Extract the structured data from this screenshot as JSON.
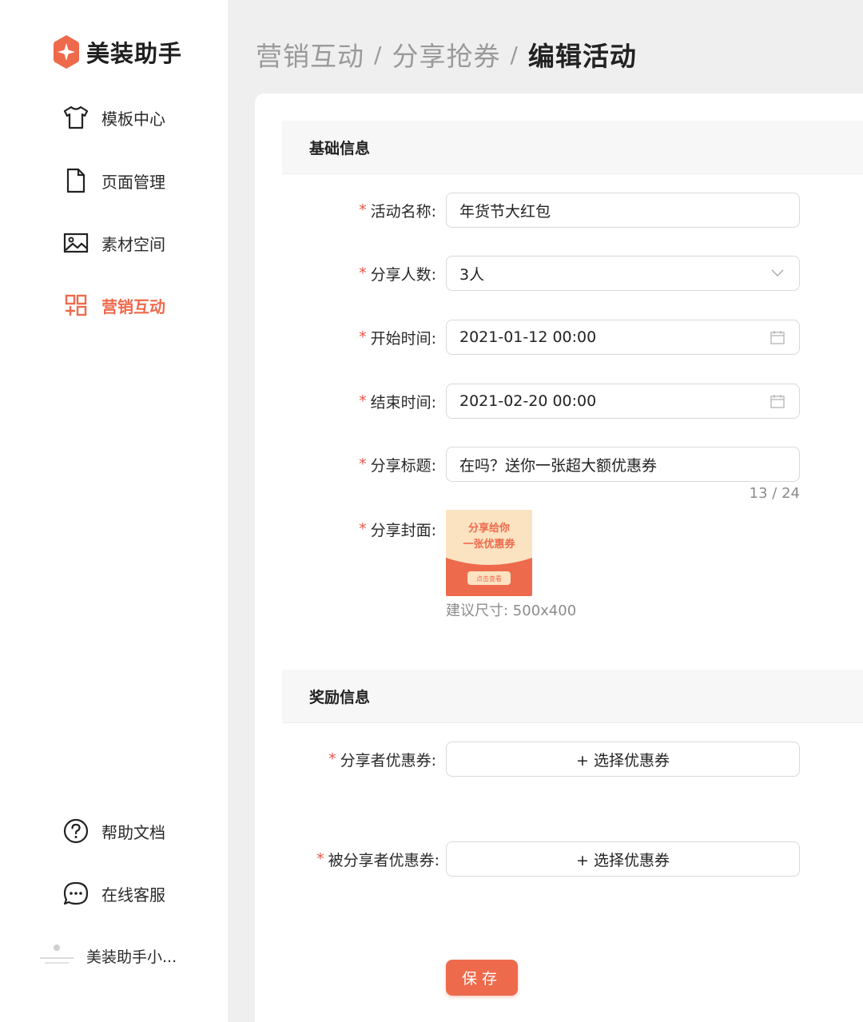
{
  "brand": {
    "name": "美装助手"
  },
  "sidebar": {
    "items": [
      {
        "label": "模板中心",
        "icon": "tshirt-icon"
      },
      {
        "label": "页面管理",
        "icon": "file-icon"
      },
      {
        "label": "素材空间",
        "icon": "image-icon"
      },
      {
        "label": "营销互动",
        "icon": "grid-plus-icon",
        "active": true
      }
    ],
    "bottom": [
      {
        "label": "帮助文档",
        "icon": "help-icon"
      },
      {
        "label": "在线客服",
        "icon": "chat-icon"
      }
    ],
    "mini_app": {
      "label": "美装助手小..."
    }
  },
  "breadcrumb": [
    "营销互动",
    "分享抢券",
    "编辑活动"
  ],
  "breadcrumb_sep": "/",
  "sections": {
    "basic": {
      "title": "基础信息"
    },
    "reward": {
      "title": "奖励信息"
    }
  },
  "form": {
    "required_mark": "*",
    "name": {
      "label": "活动名称:",
      "value": "年货节大红包"
    },
    "share_count": {
      "label": "分享人数:",
      "value": "3人"
    },
    "start_time": {
      "label": "开始时间:",
      "value": "2021-01-12 00:00"
    },
    "end_time": {
      "label": "结束时间:",
      "value": "2021-02-20 00:00"
    },
    "share_title": {
      "label": "分享标题:",
      "value": "在吗？送你一张超大额优惠券",
      "counter": "13 / 24"
    },
    "share_cover": {
      "label": "分享封面:",
      "cover_line1": "分享给你",
      "cover_line2": "一张优惠券",
      "cover_button": "点击查看",
      "hint": "建议尺寸: 500x400"
    },
    "sharer_coupon": {
      "label": "分享者优惠券:",
      "button": "+ 选择优惠券"
    },
    "invitee_coupon": {
      "label": "被分享者优惠券:",
      "button": "+ 选择优惠券"
    }
  },
  "save_label": "保存",
  "colors": {
    "accent": "#ee6a4c",
    "required": "#e8564a"
  }
}
